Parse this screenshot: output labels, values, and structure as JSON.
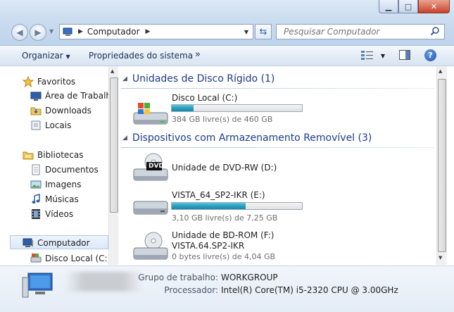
{
  "window": {
    "minimize": "▁",
    "maximize": "□",
    "close": "✕"
  },
  "nav": {
    "back_icon": "arrow-left-icon",
    "forward_icon": "arrow-right-icon",
    "breadcrumb": [
      "Computador"
    ],
    "search_placeholder": "Pesquisar Computador"
  },
  "toolbar": {
    "organize": "Organizar",
    "system_properties": "Propriedades do sistema",
    "more": "»"
  },
  "sidebar": {
    "favorites": {
      "label": "Favoritos",
      "items": [
        "Área de Trabalho",
        "Downloads",
        "Locais"
      ]
    },
    "libraries": {
      "label": "Bibliotecas",
      "items": [
        "Documentos",
        "Imagens",
        "Músicas",
        "Vídeos"
      ]
    },
    "computer": {
      "label": "Computador",
      "items": [
        "Disco Local (C:)"
      ]
    }
  },
  "groups": {
    "hdd": {
      "title": "Unidades de Disco Rígido (1)"
    },
    "removable": {
      "title": "Dispositivos com Armazenamento Removível (3)"
    }
  },
  "drives": {
    "c": {
      "name": "Disco Local (C:)",
      "free": "384 GB livre(s) de 460 GB",
      "used_fraction": 0.165
    },
    "dvd": {
      "name": "Unidade de DVD-RW (D:)",
      "badge": "DVD"
    },
    "e": {
      "name": "VISTA_64_SP2-IKR (E:)",
      "free": "3,10 GB livre(s) de 7,25 GB",
      "used_fraction": 0.57
    },
    "f": {
      "name": "Unidade de BD-ROM (F:)",
      "label": "VISTA.64.SP2-IKR",
      "free": "0 bytes livre(s) de 4,04 GB"
    }
  },
  "details": {
    "workgroup_label": "Grupo de trabalho:",
    "workgroup": "WORKGROUP",
    "processor_label": "Processador:",
    "processor": "Intel(R) Core(TM) i5-2320 CPU @ 3.00GHz"
  },
  "colors": {
    "accent_blue": "#1e3a8a",
    "bar_fill": "#26a0bf"
  }
}
